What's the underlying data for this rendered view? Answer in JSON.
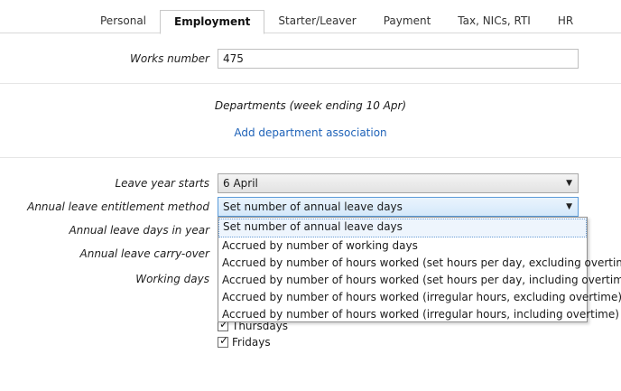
{
  "tabs": [
    {
      "label": "Personal"
    },
    {
      "label": "Employment",
      "active": true
    },
    {
      "label": "Starter/Leaver"
    },
    {
      "label": "Payment"
    },
    {
      "label": "Tax, NICs, RTI"
    },
    {
      "label": "HR"
    }
  ],
  "works_number": {
    "label": "Works number",
    "value": "475"
  },
  "departments": {
    "heading": "Departments (week ending 10 Apr)",
    "add_link": "Add department association"
  },
  "leave_year": {
    "label": "Leave year starts",
    "value": "6 April"
  },
  "entitlement": {
    "label": "Annual leave entitlement method",
    "value": "Set number of annual leave days",
    "options": [
      "Set number of annual leave days",
      "Accrued by number of working days",
      "Accrued by number of hours worked (set hours per day, excluding overtime)",
      "Accrued by number of hours worked (set hours per day, including overtime)",
      "Accrued by number of hours worked (irregular hours, excluding overtime)",
      "Accrued by number of hours worked (irregular hours, including overtime)"
    ]
  },
  "leave_days_label": "Annual leave days in year",
  "carry_over_label": "Annual leave carry-over",
  "working_days": {
    "label": "Working days",
    "days": [
      {
        "label": "Thursdays",
        "checked": true
      },
      {
        "label": "Fridays",
        "checked": true
      }
    ]
  },
  "icons": {
    "dropdown_arrow": "▼",
    "checkmark": "✓"
  }
}
